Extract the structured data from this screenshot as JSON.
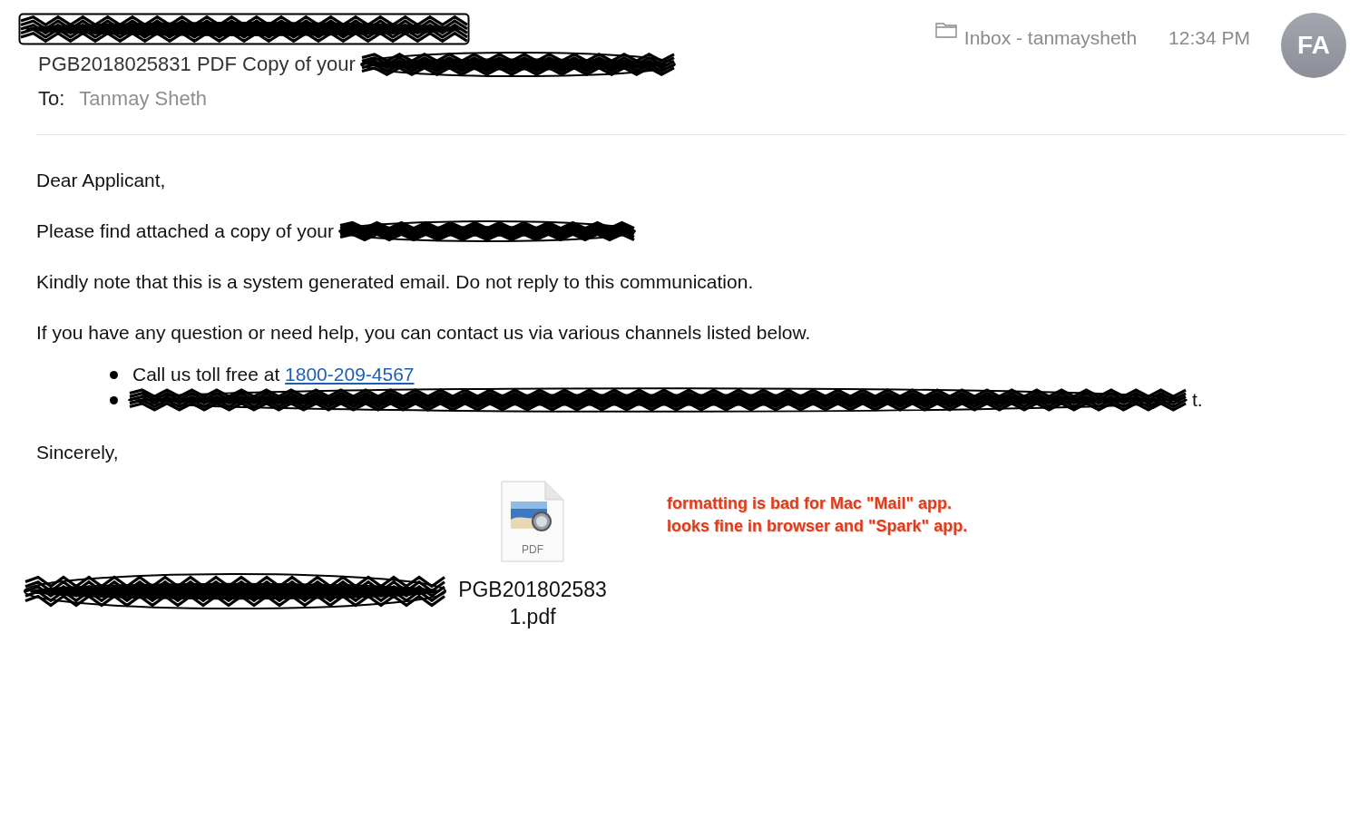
{
  "header": {
    "sender": {
      "redacted": true
    },
    "subject": {
      "text": "PGB2018025831 PDF Copy of your",
      "redacted": true
    },
    "to_label": "To:",
    "to": "Tanmay Sheth",
    "mailbox": "Inbox - tanmaysheth",
    "time": "12:34 PM",
    "avatar": "FA"
  },
  "body": [
    {
      "kind": "paragraph",
      "text": "Dear Applicant,"
    },
    {
      "kind": "paragraph",
      "text": "Please find attached a copy of your",
      "redacted": true
    },
    {
      "kind": "paragraph",
      "text": "Kindly note that this is a system generated email. Do not reply to this communication."
    },
    {
      "kind": "paragraph",
      "text": "If you have any question or need help, you can contact us via various channels listed below."
    },
    {
      "kind": "bullets",
      "items": [
        {
          "text": "Call us toll free at ",
          "link": "1800-209-4567"
        },
        {
          "redacted": true,
          "tail": "t."
        }
      ]
    },
    {
      "kind": "paragraph",
      "text": "Sincerely,"
    }
  ],
  "attachment": {
    "type_label": "PDF",
    "redacted": true,
    "filename_lines": [
      "PGB201802583",
      "1.pdf"
    ]
  },
  "annotation": {
    "lines": [
      "formatting is bad for Mac \"Mail\" app.",
      "looks fine in browser and \"Spark\" app."
    ]
  }
}
